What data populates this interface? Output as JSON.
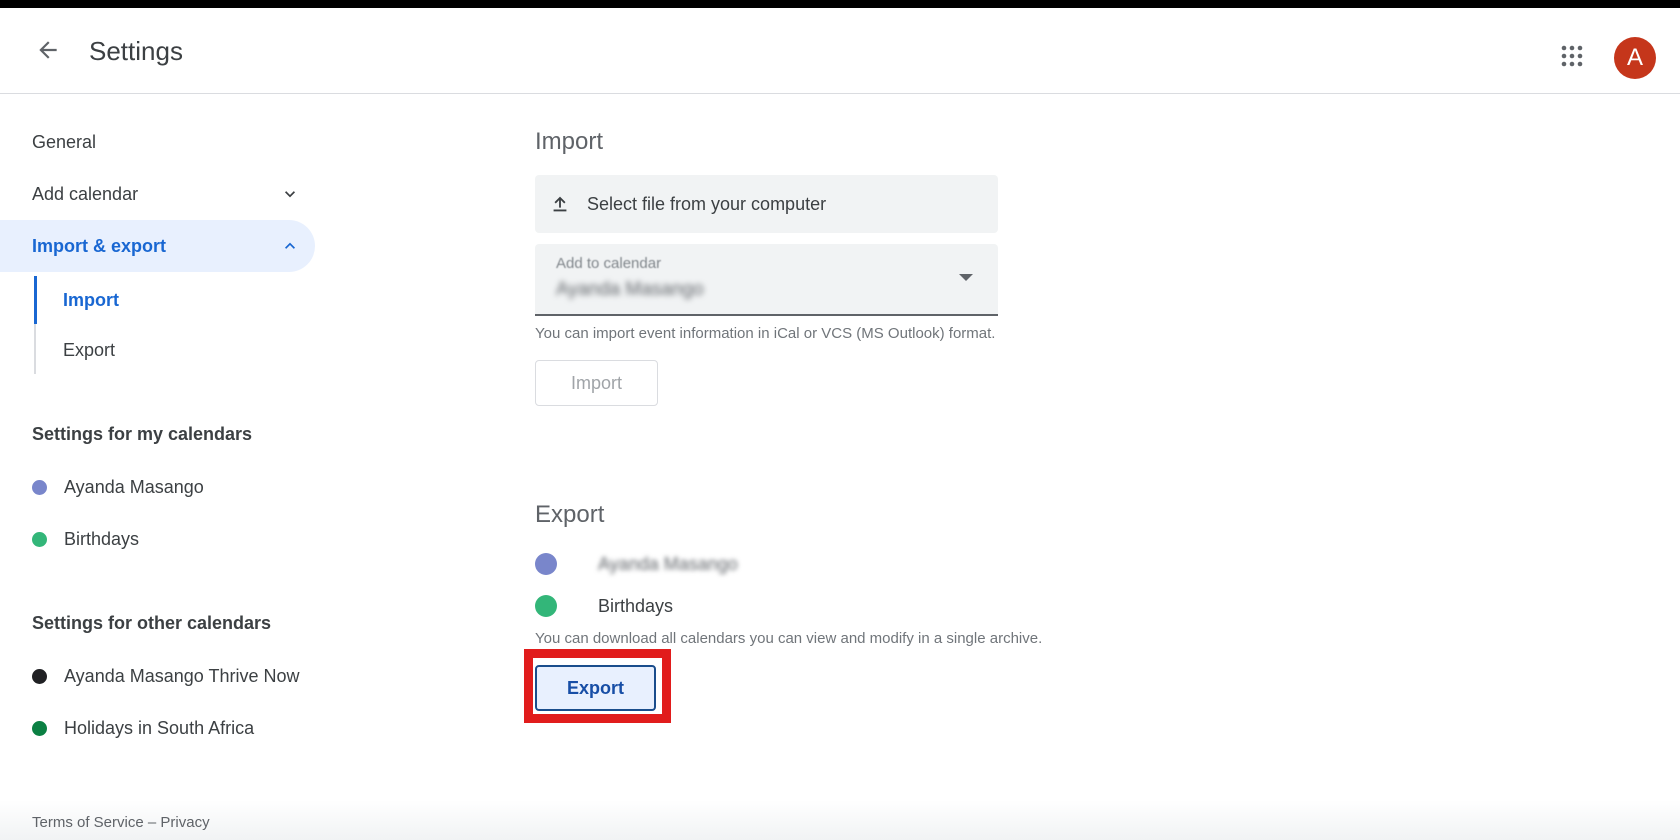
{
  "header": {
    "title": "Settings",
    "back_icon": "arrow-back-icon",
    "apps_icon": "apps-grid-icon",
    "avatar_letter": "A",
    "avatar_color": "#c5361b"
  },
  "sidebar": {
    "general": "General",
    "add_calendar": "Add calendar",
    "import_export": "Import & export",
    "sub": {
      "import": "Import",
      "export": "Export"
    },
    "my_calendars_heading": "Settings for my calendars",
    "my_calendars": [
      {
        "name": "Ayanda Masango",
        "color": "#7986cb"
      },
      {
        "name": "Birthdays",
        "color": "#33b679"
      }
    ],
    "other_calendars_heading": "Settings for other calendars",
    "other_calendars": [
      {
        "name": "Ayanda Masango Thrive Now",
        "color": "#202124"
      },
      {
        "name": "Holidays in South Africa",
        "color": "#0b8043"
      }
    ]
  },
  "import": {
    "title": "Import",
    "file_picker": "Select file from your computer",
    "select_label": "Add to calendar",
    "select_value": "Ayanda Masango",
    "helper": "You can import event information in iCal or VCS (MS Outlook) format.",
    "button": "Import"
  },
  "export": {
    "title": "Export",
    "calendars": [
      {
        "name": "Ayanda Masango",
        "color": "#7986cb"
      },
      {
        "name": "Birthdays",
        "color": "#33b679"
      }
    ],
    "helper": "You can download all calendars you can view and modify in a single archive.",
    "button": "Export"
  },
  "footer": {
    "terms": "Terms of Service",
    "separator": "–",
    "privacy": "Privacy"
  }
}
